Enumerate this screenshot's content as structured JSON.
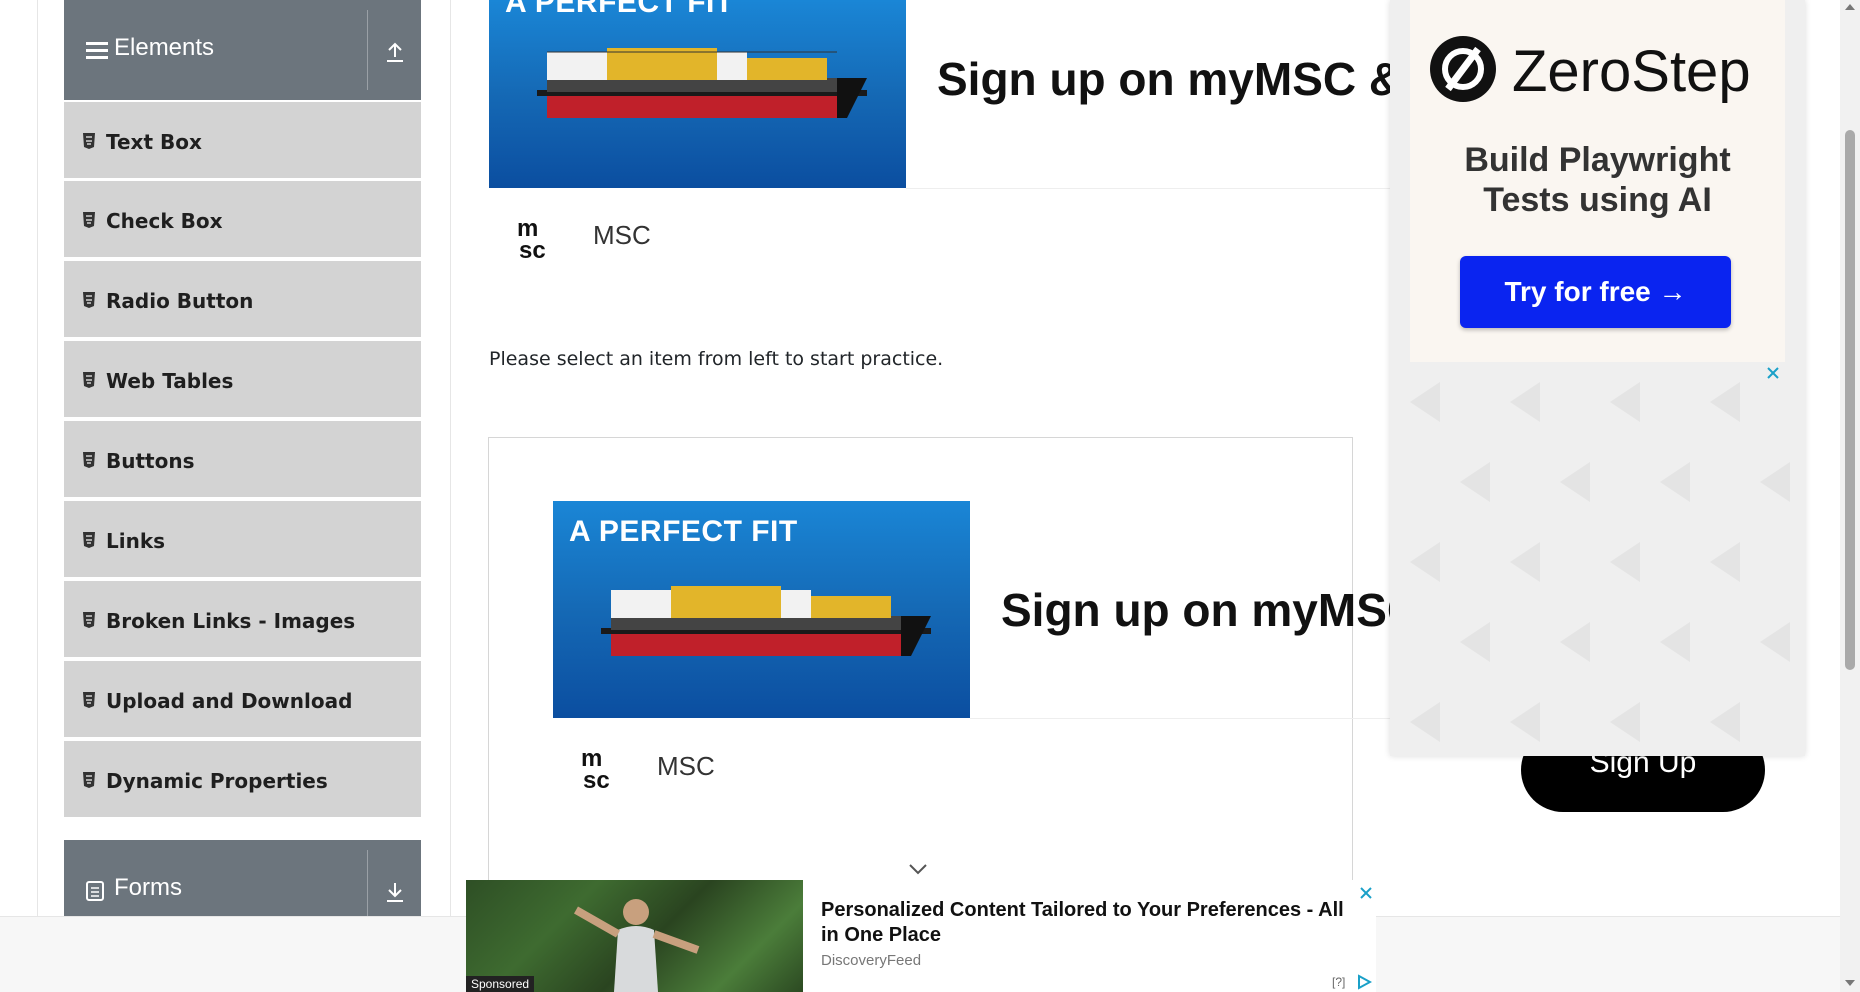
{
  "sidebar": {
    "elements_header": "Elements",
    "items": [
      {
        "label": "Text Box"
      },
      {
        "label": "Check Box"
      },
      {
        "label": "Radio Button"
      },
      {
        "label": "Web Tables"
      },
      {
        "label": "Buttons"
      },
      {
        "label": "Links"
      },
      {
        "label": "Broken Links - Images"
      },
      {
        "label": "Upload and Download"
      },
      {
        "label": "Dynamic Properties"
      }
    ],
    "forms_header": "Forms"
  },
  "ad_top": {
    "tag": "A PERFECT FIT",
    "headline": "Sign up on myMSC & B",
    "brand": "MSC"
  },
  "main": {
    "practice_text": "Please select an item from left to start practice."
  },
  "ad_middle": {
    "tag": "A PERFECT FIT",
    "headline": "Sign up on myMSC",
    "brand": "MSC",
    "cta": "Sign Up"
  },
  "right_ad": {
    "brand": "ZeroStep",
    "subtitle_line1": "Build Playwright",
    "subtitle_line2": "Tests using AI",
    "cta": "Try for free →"
  },
  "bottom_ad": {
    "title": "Personalized Content Tailored to Your Preferences - All in One Place",
    "source": "DiscoveryFeed",
    "sponsored": "Sponsored",
    "info": "[?]"
  },
  "colors": {
    "sidebar_header": "#6c757d",
    "sidebar_item": "#d3d3d3",
    "cta_blue": "#0a24f0"
  }
}
